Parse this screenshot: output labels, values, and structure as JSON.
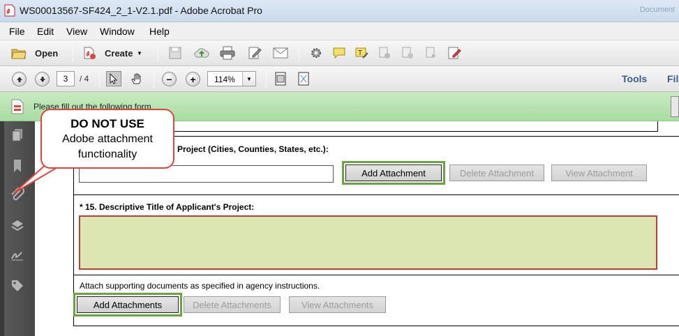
{
  "window": {
    "title": "WS00013567-SF424_2_1-V2.1.pdf - Adobe Acrobat Pro",
    "ghost_text": "Document"
  },
  "menu": [
    "File",
    "Edit",
    "View",
    "Window",
    "Help"
  ],
  "toolbar": {
    "open_label": "Open",
    "create_label": "Create"
  },
  "nav": {
    "current_page": "3",
    "page_total": "/ 4",
    "zoom": "114%",
    "tools_label": "Tools",
    "fill_label": "Fil"
  },
  "form_bar": {
    "message": "Please fill out the following form."
  },
  "callout": {
    "line1": "DO NOT USE",
    "line2": "Adobe attachment",
    "line3": "functionality"
  },
  "form": {
    "q14_label": "Project (Cities, Counties, States, etc.):",
    "q14_buttons": {
      "add": "Add Attachment",
      "delete": "Delete Attachment",
      "view": "View Attachment"
    },
    "q15_label": "* 15. Descriptive Title of Applicant's Project:",
    "supporting_text": "Attach supporting documents as specified in agency instructions.",
    "supporting_buttons": {
      "add": "Add Attachments",
      "delete": "Delete Attachments",
      "view": "View Attachments"
    }
  },
  "colors": {
    "form_bar": "#b7e2b0",
    "highlight": "#6aa342",
    "callout_border": "#d9473f",
    "required_field": "#dce6b2",
    "required_border": "#b8403c"
  }
}
